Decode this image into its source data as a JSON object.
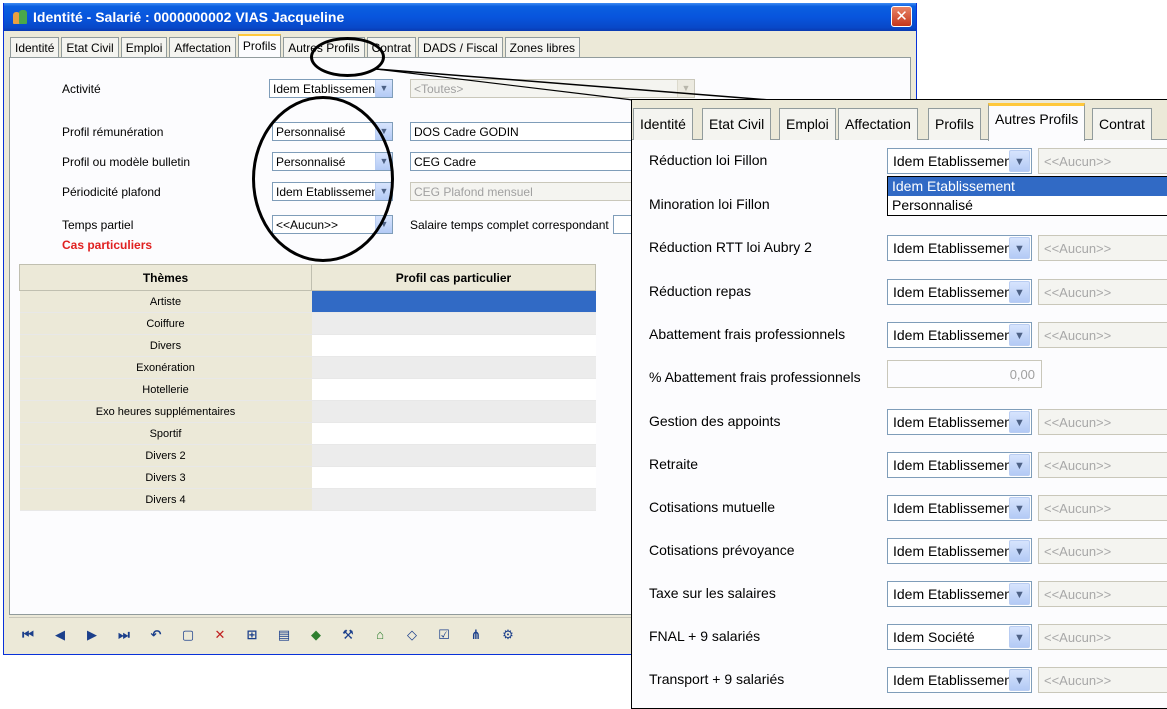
{
  "window": {
    "title": "Identité - Salarié : 0000000002 VIAS Jacqueline",
    "close": "✕"
  },
  "tabs": [
    "Identité",
    "Etat Civil",
    "Emploi",
    "Affectation",
    "Profils",
    "Autres Profils",
    "Contrat",
    "DADS / Fiscal",
    "Zones libres"
  ],
  "active_tab": "Profils",
  "form": {
    "activite": {
      "label": "Activité",
      "value": "Idem Etablissement",
      "disabled_value": "<Toutes>"
    },
    "profil_remuneration": {
      "label": "Profil rémunération",
      "value": "Personnalisé",
      "detail": "DOS Cadre GODIN"
    },
    "profil_modele_bulletin": {
      "label": "Profil ou modèle bulletin",
      "value": "Personnalisé",
      "detail": "CEG Cadre"
    },
    "periodicite_plafond": {
      "label": "Périodicité plafond",
      "value": "Idem Etablissement",
      "detail": "CEG Plafond mensuel"
    },
    "temps_partiel": {
      "label": "Temps partiel",
      "value": "<<Aucun>>",
      "salaire_label": "Salaire temps complet correspondant"
    },
    "cas_particuliers": "Cas particuliers"
  },
  "grid": {
    "headers": [
      "Thèmes",
      "Profil cas particulier"
    ],
    "rows": [
      "Artiste",
      "Coiffure",
      "Divers",
      "Exonération",
      "Hotellerie",
      "Exo heures supplémentaires",
      "Sportif",
      "Divers 2",
      "Divers 3",
      "Divers 4"
    ]
  },
  "toolbar": {
    "icons": [
      "first-icon",
      "prev-icon",
      "next-icon",
      "last-icon",
      "undo-icon",
      "new-document-icon",
      "delete-icon",
      "filter-icon",
      "table-icon",
      "book-icon",
      "tools-icon",
      "bank-icon",
      "eraser-icon",
      "properties-icon",
      "tree-icon",
      "options-icon"
    ]
  },
  "zoom": {
    "tabs": [
      "Identité",
      "Etat Civil",
      "Emploi",
      "Affectation",
      "Profils",
      "Autres Profils",
      "Contrat"
    ],
    "active_tab": "Autres Profils",
    "rows": [
      {
        "label": "Réduction loi Fillon",
        "value": "Idem Etablissement",
        "detail": "<<Aucun>>"
      },
      {
        "label": "Minoration loi Fillon",
        "value": "",
        "detail": ""
      },
      {
        "label": "Réduction RTT loi Aubry 2",
        "value": "Idem Etablissement",
        "detail": "<<Aucun>>"
      },
      {
        "label": "Réduction repas",
        "value": "Idem Etablissement",
        "detail": "<<Aucun>>"
      },
      {
        "label": "Abattement frais professionnels",
        "value": "Idem Etablissement",
        "detail": "<<Aucun>>"
      },
      {
        "label": "% Abattement frais professionnels",
        "value": "0,00",
        "detail": ""
      },
      {
        "label": "Gestion des appoints",
        "value": "Idem Etablissement",
        "detail": "<<Aucun>>"
      },
      {
        "label": "Retraite",
        "value": "Idem Etablissement",
        "detail": "<<Aucun>>"
      },
      {
        "label": "Cotisations mutuelle",
        "value": "Idem Etablissement",
        "detail": "<<Aucun>>"
      },
      {
        "label": "Cotisations prévoyance",
        "value": "Idem Etablissement",
        "detail": "<<Aucun>>"
      },
      {
        "label": "Taxe sur les salaires",
        "value": "Idem Etablissement",
        "detail": "<<Aucun>>"
      },
      {
        "label": "FNAL + 9 salariés",
        "value": "Idem Société",
        "detail": "<<Aucun>>"
      },
      {
        "label": "Transport + 9 salariés",
        "value": "Idem Etablissement",
        "detail": "<<Aucun>>"
      }
    ],
    "dropdown_options": [
      "Idem Etablissement",
      "Personnalisé"
    ]
  }
}
